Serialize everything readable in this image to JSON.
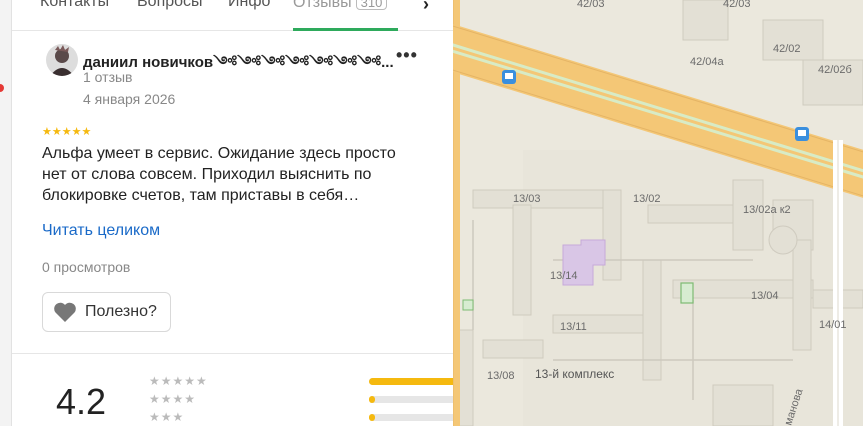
{
  "tabs": [
    {
      "label": "Контакты"
    },
    {
      "label": "Вопросы"
    },
    {
      "label": "Инфо"
    },
    {
      "label": "Отзывы",
      "badge": "310"
    }
  ],
  "review": {
    "author": "даниил новичков༺༺༺༺༺༺༺...",
    "reviews_count": "1 отзыв",
    "date": "4 января 2026",
    "stars": "★★★★★",
    "rating": 5,
    "text": "Альфа умеет в сервис. Ожидание здесь просто нет от слова совсем. Приходил выяснить по блокировке счетов, там приставы в себя…",
    "read_more": "Читать целиком",
    "views": "0 просмотров",
    "useful_label": "Полезно?",
    "more_icon": "more-dots-icon"
  },
  "summary": {
    "rating": "4.2",
    "rows": [
      {
        "stars": "★★★★★",
        "fraction": 0.99
      },
      {
        "stars": "★★★★",
        "fraction": 0.03
      },
      {
        "stars": "★★★",
        "fraction": 0.03
      }
    ]
  },
  "map": {
    "labels": {
      "l4203": "42/03",
      "l4202": "42/02",
      "l4204a": "42/04а",
      "l4202b": "42/02б",
      "l1303": "13/03",
      "l1302": "13/02",
      "l1302ak2": "13/02а к2",
      "l1314": "13/14",
      "l1304": "13/04",
      "l1311": "13/11",
      "l1401": "14/01",
      "l1308": "13/08",
      "complex": "13-й комплекс",
      "street": "манова"
    }
  },
  "colors": {
    "accent": "#2eaa5c",
    "star": "#f5b90f",
    "link": "#1a6ac8"
  }
}
